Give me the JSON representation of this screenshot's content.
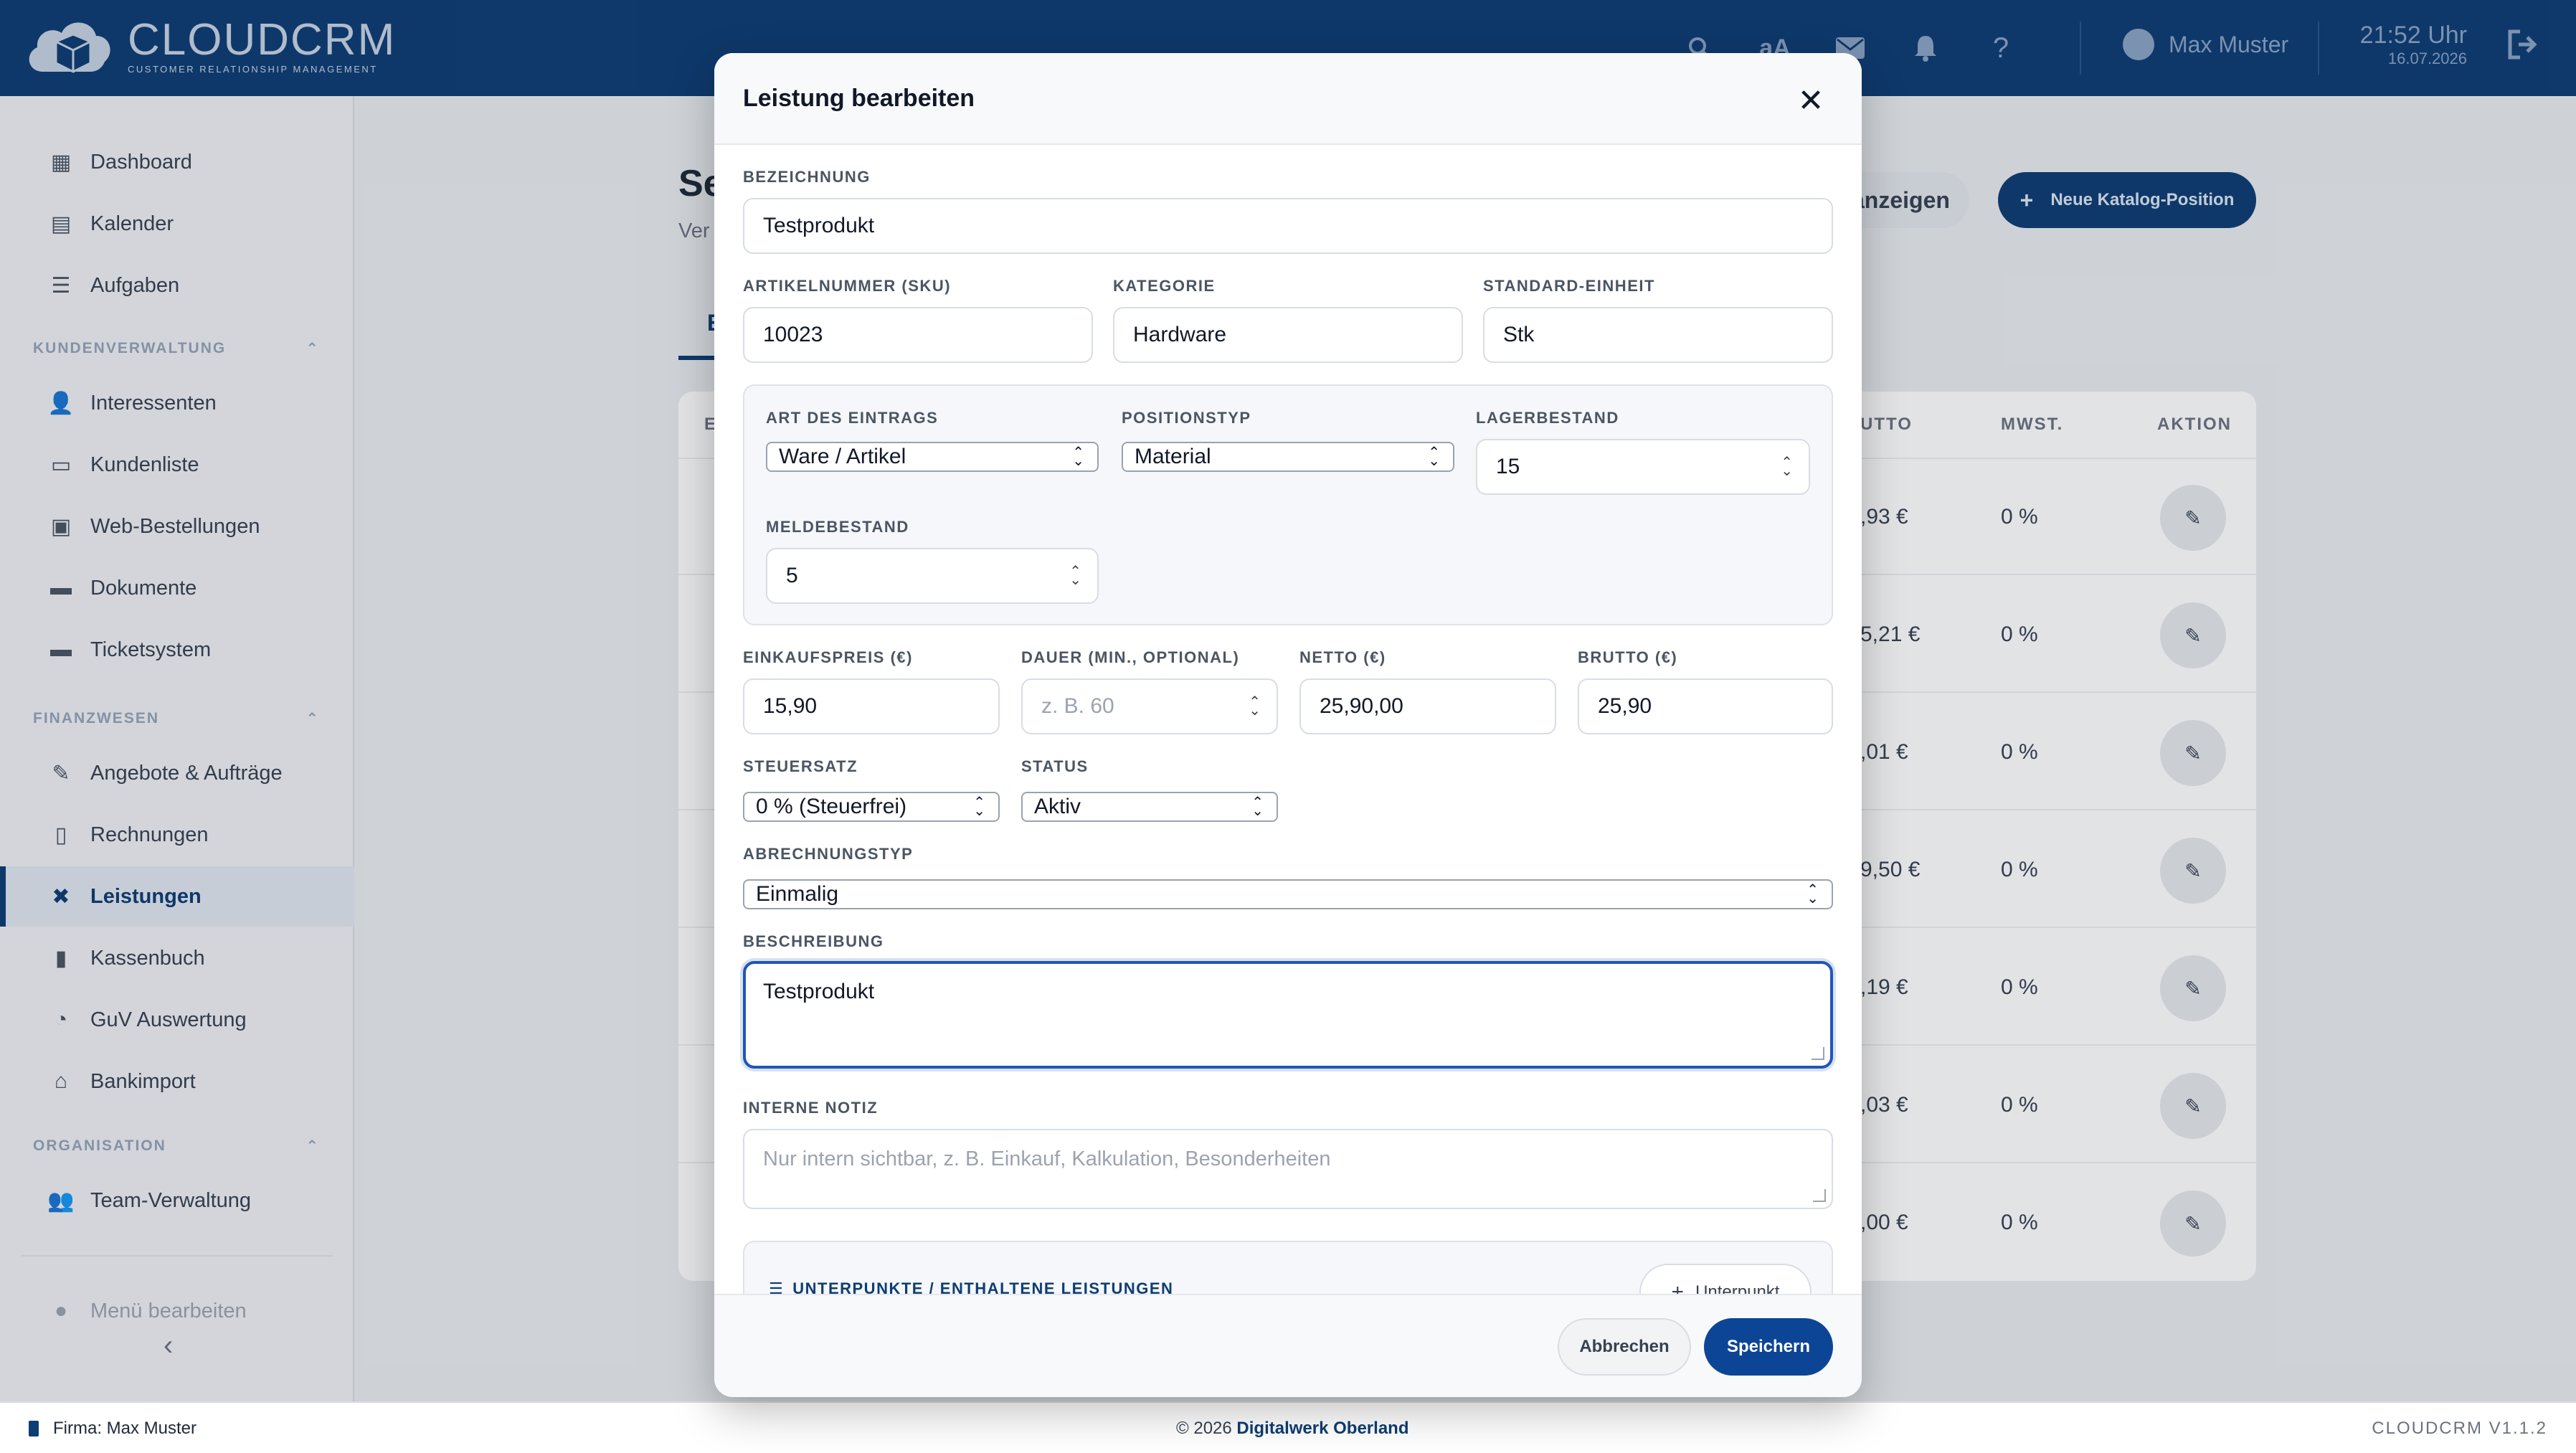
{
  "app": {
    "logo_title": "CLOUDCRM",
    "logo_subtitle": "CUSTOMER RELATIONSHIP MANAGEMENT",
    "accent_color": "#0e3d73"
  },
  "topbar": {
    "icons": [
      "search-icon",
      "font-size-icon",
      "mail-icon",
      "bell-icon",
      "help-icon"
    ],
    "font_toggle_label": "aA",
    "user_name": "Max Muster",
    "time": "21:52 Uhr",
    "date": "16.07.2026"
  },
  "sidebar": {
    "items_top": [
      {
        "label": "Dashboard",
        "icon": "dashboard-icon"
      },
      {
        "label": "Kalender",
        "icon": "calendar-icon"
      },
      {
        "label": "Aufgaben",
        "icon": "tasks-icon"
      }
    ],
    "section_customers": "KUNDENVERWALTUNG",
    "items_customers": [
      {
        "label": "Interessenten",
        "icon": "user-plus-icon"
      },
      {
        "label": "Kundenliste",
        "icon": "id-card-icon"
      },
      {
        "label": "Web-Bestellungen",
        "icon": "shopping-bag-icon"
      },
      {
        "label": "Dokumente",
        "icon": "folder-icon"
      },
      {
        "label": "Ticketsystem",
        "icon": "ticket-icon"
      }
    ],
    "section_finance": "FINANZWESEN",
    "items_finance": [
      {
        "label": "Angebote & Aufträge",
        "icon": "file-edit-icon"
      },
      {
        "label": "Rechnungen",
        "icon": "invoice-icon"
      },
      {
        "label": "Leistungen",
        "icon": "tools-icon",
        "active": true
      },
      {
        "label": "Kassenbuch",
        "icon": "book-icon"
      },
      {
        "label": "GuV Auswertung",
        "icon": "pie-chart-icon"
      },
      {
        "label": "Bankimport",
        "icon": "bank-icon"
      }
    ],
    "section_org": "ORGANISATION",
    "items_org": [
      {
        "label": "Team-Verwaltung",
        "icon": "team-icon"
      }
    ],
    "edit_menu": "Menü bearbeiten"
  },
  "background": {
    "title_fragment": "Se",
    "subtitle_fragment": "Ver",
    "ghost_button_fragment": "anzeigen",
    "primary_button": "Neue Katalog-Position",
    "tab_fragment": "E",
    "table_headers": {
      "brutto": "UTTO",
      "mwst": "MWST.",
      "aktion": "AKTION",
      "first": "E"
    },
    "rows": [
      {
        "brutto": ",93 €",
        "mwst": "0 %"
      },
      {
        "brutto": "5,21 €",
        "mwst": "0 %"
      },
      {
        "brutto": ",01 €",
        "mwst": "0 %"
      },
      {
        "brutto": "9,50 €",
        "mwst": "0 %"
      },
      {
        "brutto": ",19 €",
        "mwst": "0 %"
      },
      {
        "brutto": ",03 €",
        "mwst": "0 %"
      },
      {
        "brutto": ",00 €",
        "mwst": "0 %"
      }
    ]
  },
  "modal": {
    "title": "Leistung bearbeiten",
    "bezeichnung": {
      "label": "BEZEICHNUNG",
      "value": "Testprodukt"
    },
    "sku": {
      "label": "ARTIKELNUMMER (SKU)",
      "value": "10023"
    },
    "kategorie": {
      "label": "KATEGORIE",
      "value": "Hardware"
    },
    "einheit": {
      "label": "STANDARD-EINHEIT",
      "value": "Stk"
    },
    "art": {
      "label": "ART DES EINTRAGS",
      "value": "Ware / Artikel"
    },
    "positionstyp": {
      "label": "POSITIONSTYP",
      "value": "Material"
    },
    "lagerbestand": {
      "label": "LAGERBESTAND",
      "value": "15"
    },
    "meldebestand": {
      "label": "MELDEBESTAND",
      "value": "5"
    },
    "einkaufspreis": {
      "label": "EINKAUFSPREIS (€)",
      "value": "15,90"
    },
    "dauer": {
      "label": "DAUER (MIN., OPTIONAL)",
      "placeholder": "z. B. 60"
    },
    "netto": {
      "label": "NETTO (€)",
      "value": "25,90,00"
    },
    "brutto": {
      "label": "BRUTTO (€)",
      "value": "25,90"
    },
    "steuersatz": {
      "label": "STEUERSATZ",
      "value": "0 % (Steuerfrei)"
    },
    "status": {
      "label": "STATUS",
      "value": "Aktiv"
    },
    "abrechnungstyp": {
      "label": "ABRECHNUNGSTYP",
      "value": "Einmalig"
    },
    "beschreibung": {
      "label": "BESCHREIBUNG",
      "value": "Testprodukt"
    },
    "interne_notiz": {
      "label": "INTERNE NOTIZ",
      "placeholder": "Nur intern sichtbar, z. B. Einkauf, Kalkulation, Besonderheiten"
    },
    "unterpunkte": {
      "title": "UNTERPUNKTE / ENTHALTENE LEISTUNGEN",
      "button": "Unterpunkt"
    },
    "cancel": "Abbrechen",
    "save": "Speichern"
  },
  "footer": {
    "firm": "Firma: Max Muster",
    "copyright_prefix": "© 2026",
    "copyright_link": "Digitalwerk Oberland",
    "version": "CLOUDCRM V1.1.2"
  }
}
